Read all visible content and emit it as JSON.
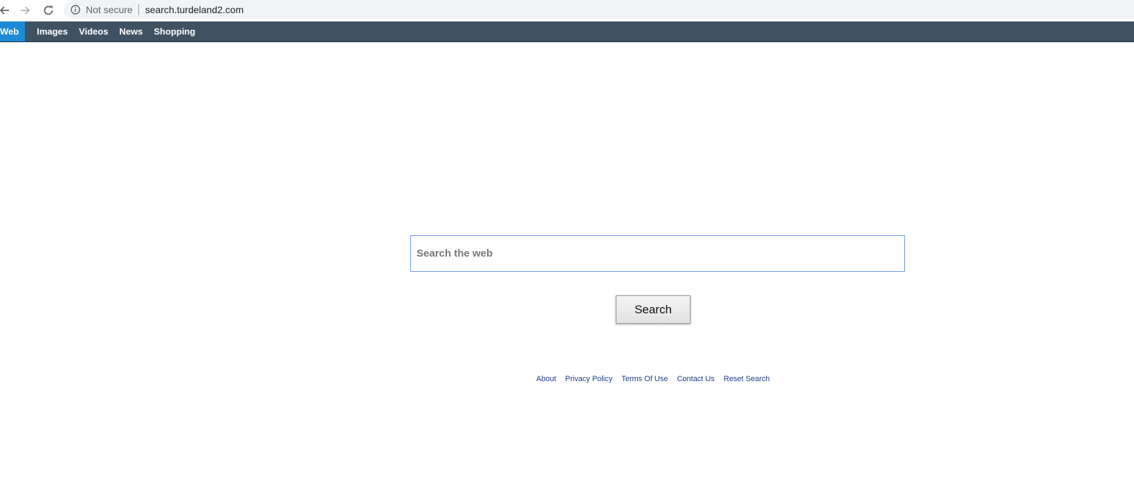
{
  "browser": {
    "security_label": "Not secure",
    "url": "search.turdeland2.com",
    "icons": [
      "back-arrow-icon",
      "forward-arrow-icon",
      "reload-icon",
      "info-icon"
    ]
  },
  "topnav": {
    "tabs": [
      {
        "label": "Web",
        "active": true
      },
      {
        "label": "Images",
        "active": false
      },
      {
        "label": "Videos",
        "active": false
      },
      {
        "label": "News",
        "active": false
      },
      {
        "label": "Shopping",
        "active": false
      }
    ]
  },
  "search": {
    "placeholder": "Search the web",
    "value": "",
    "button_label": "Search"
  },
  "footer": {
    "links": [
      "About",
      "Privacy Policy",
      "Terms Of Use",
      "Contact Us",
      "Reset Search"
    ]
  },
  "colors": {
    "nav_background": "#3e5263",
    "active_tab": "#1e8ad6",
    "link": "#1b3c8a",
    "input_border": "#6d9bf0"
  }
}
